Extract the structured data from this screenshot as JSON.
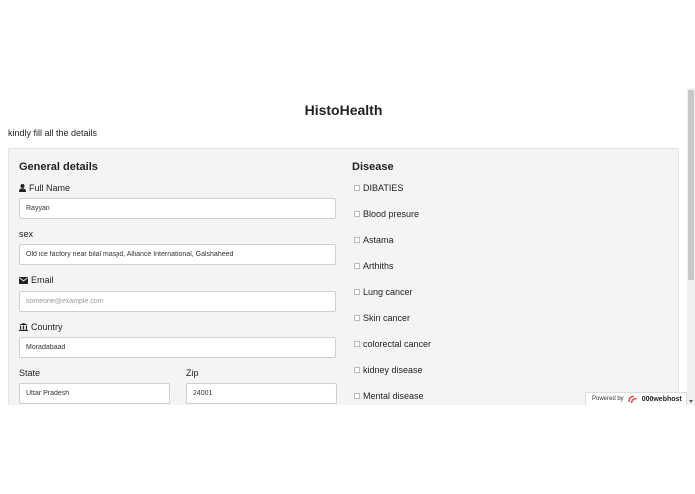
{
  "page": {
    "title": "HistoHealth",
    "instruction": "kindly fill all the details"
  },
  "general": {
    "title": "General details",
    "full_name_label": "Full Name",
    "full_name_value": "Rayyan",
    "sex_label": "sex",
    "sex_value": "Old ice factory near bilal masjid, Alliance International, Galshaheed",
    "email_label": "Email",
    "email_placeholder": "someone@example.com",
    "country_label": "Country",
    "country_value": "Moradabaad",
    "state_label": "State",
    "state_value": "Uttar Pradesh",
    "zip_label": "Zip",
    "zip_value": "24001"
  },
  "disease": {
    "title": "Disease",
    "items": [
      "DIBATIES",
      "Blood presure",
      "Astama",
      "Arthiths",
      "Lung cancer",
      "Skin cancer",
      "colorectal cancer",
      "kidney disease",
      "Mental disease"
    ]
  },
  "footer": {
    "powered_by": "Powered by",
    "brand": "000webhost"
  },
  "icons": {
    "full_name": "user-icon",
    "email": "envelope-icon",
    "country": "bank-icon",
    "brand": "webhost-logo-icon"
  },
  "colors": {
    "panel_bg": "#f4f4f4",
    "brand_accent": "#e8423b"
  }
}
